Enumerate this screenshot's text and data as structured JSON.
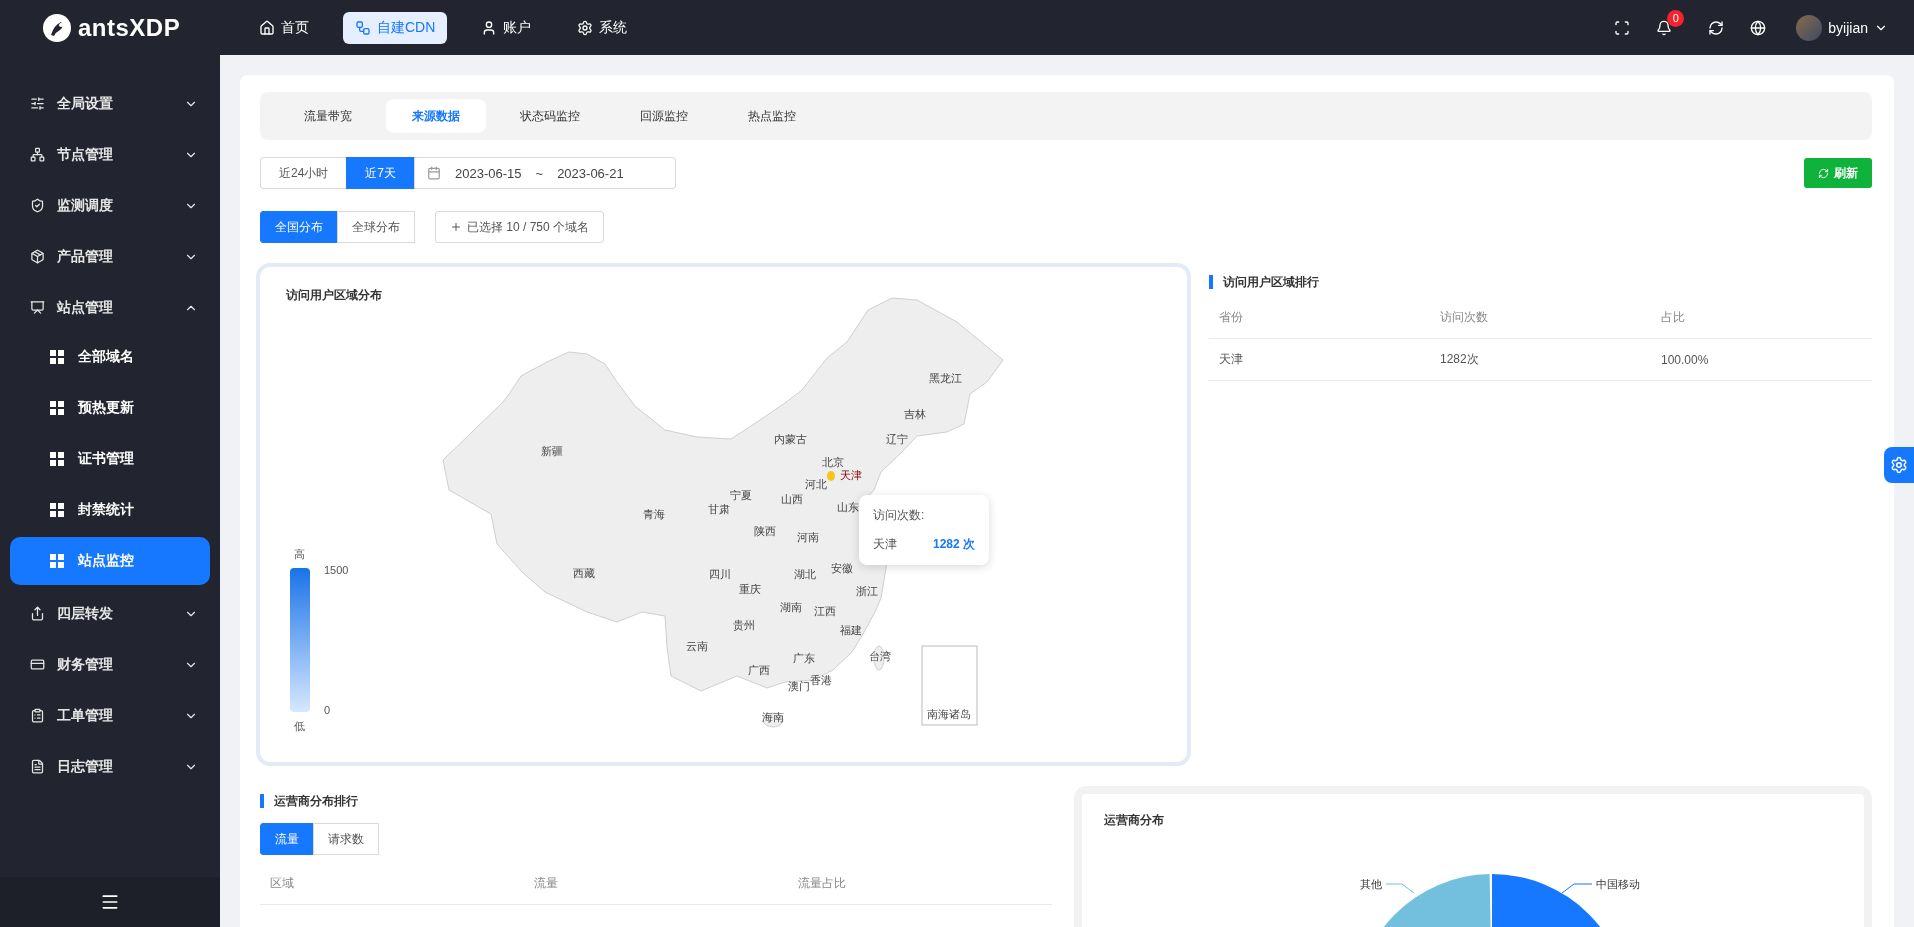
{
  "logo": {
    "text": "antsXDP"
  },
  "top_nav": [
    {
      "label": "首页",
      "selected": false
    },
    {
      "label": "自建CDN",
      "selected": true
    },
    {
      "label": "账户",
      "selected": false
    },
    {
      "label": "系统",
      "selected": false
    }
  ],
  "header": {
    "notification_count": "0",
    "user": "byijian"
  },
  "sidebar": {
    "items": [
      {
        "label": "全局设置",
        "expanded": false
      },
      {
        "label": "节点管理",
        "expanded": false
      },
      {
        "label": "监测调度",
        "expanded": false
      },
      {
        "label": "产品管理",
        "expanded": false
      },
      {
        "label": "站点管理",
        "expanded": true,
        "children": [
          {
            "label": "全部域名",
            "selected": false
          },
          {
            "label": "预热更新",
            "selected": false
          },
          {
            "label": "证书管理",
            "selected": false
          },
          {
            "label": "封禁统计",
            "selected": false
          },
          {
            "label": "站点监控",
            "selected": true
          }
        ]
      },
      {
        "label": "四层转发",
        "expanded": false
      },
      {
        "label": "财务管理",
        "expanded": false
      },
      {
        "label": "工单管理",
        "expanded": false
      },
      {
        "label": "日志管理",
        "expanded": false
      }
    ]
  },
  "tabs": [
    {
      "label": "流量带宽",
      "selected": false
    },
    {
      "label": "来源数据",
      "selected": true
    },
    {
      "label": "状态码监控",
      "selected": false
    },
    {
      "label": "回源监控",
      "selected": false
    },
    {
      "label": "热点监控",
      "selected": false
    }
  ],
  "time_range": {
    "options": [
      {
        "label": "近24小时",
        "selected": false
      },
      {
        "label": "近7天",
        "selected": true
      }
    ],
    "start": "2023-06-15",
    "separator": "~",
    "end": "2023-06-21"
  },
  "refresh_button": "刷新",
  "scope": [
    {
      "label": "全国分布",
      "selected": true
    },
    {
      "label": "全球分布",
      "selected": false
    }
  ],
  "domain_picker": "已选择 10 / 750 个域名",
  "map_panel": {
    "title": "访问用户区域分布",
    "legend": {
      "high_label": "高",
      "max": "1500",
      "min": "0",
      "low_label": "低"
    },
    "regions": [
      {
        "name": "新疆",
        "highlighted": false
      },
      {
        "name": "西藏",
        "highlighted": false
      },
      {
        "name": "青海",
        "highlighted": false
      },
      {
        "name": "甘肃",
        "highlighted": false
      },
      {
        "name": "宁夏",
        "highlighted": false
      },
      {
        "name": "内蒙古",
        "highlighted": false
      },
      {
        "name": "黑龙江",
        "highlighted": false
      },
      {
        "name": "吉林",
        "highlighted": false
      },
      {
        "name": "辽宁",
        "highlighted": false
      },
      {
        "name": "北京",
        "highlighted": false
      },
      {
        "name": "天津",
        "highlighted": true
      },
      {
        "name": "河北",
        "highlighted": false
      },
      {
        "name": "山西",
        "highlighted": false
      },
      {
        "name": "山东",
        "highlighted": false
      },
      {
        "name": "陕西",
        "highlighted": false
      },
      {
        "name": "河南",
        "highlighted": false
      },
      {
        "name": "四川",
        "highlighted": false
      },
      {
        "name": "重庆",
        "highlighted": false
      },
      {
        "name": "湖北",
        "highlighted": false
      },
      {
        "name": "安徽",
        "highlighted": false
      },
      {
        "name": "浙江",
        "highlighted": false
      },
      {
        "name": "湖南",
        "highlighted": false
      },
      {
        "name": "江西",
        "highlighted": false
      },
      {
        "name": "贵州",
        "highlighted": false
      },
      {
        "name": "福建",
        "highlighted": false
      },
      {
        "name": "云南",
        "highlighted": false
      },
      {
        "name": "广东",
        "highlighted": false
      },
      {
        "name": "台湾",
        "highlighted": false
      },
      {
        "name": "广西",
        "highlighted": false
      },
      {
        "name": "香港",
        "highlighted": false
      },
      {
        "name": "澳门",
        "highlighted": false
      },
      {
        "name": "海南",
        "highlighted": false
      }
    ],
    "inset_label": "南海诸岛",
    "tooltip": {
      "title": "访问次数:",
      "region": "天津",
      "value": "1282 次"
    }
  },
  "region_ranking": {
    "title": "访问用户区域排行",
    "columns": [
      "省份",
      "访问次数",
      "占比"
    ],
    "rows": [
      [
        "天津",
        "1282次",
        "100.00%"
      ]
    ]
  },
  "isp_ranking": {
    "title": "运营商分布排行",
    "metric_tabs": [
      {
        "label": "流量",
        "selected": true
      },
      {
        "label": "请求数",
        "selected": false
      }
    ],
    "columns": [
      "区域",
      "流量",
      "流量占比"
    ]
  },
  "isp_pie": {
    "title": "运营商分布",
    "labels": [
      "其他",
      "中国移动"
    ]
  }
}
